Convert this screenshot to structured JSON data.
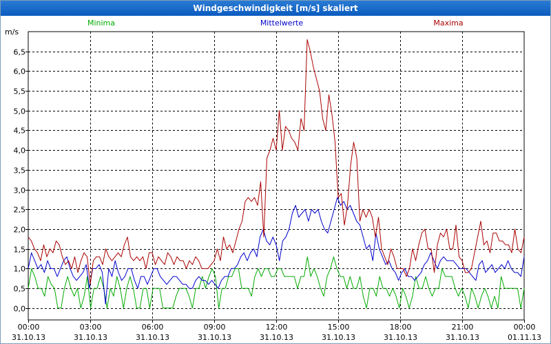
{
  "window": {
    "title": "Windgeschwindigkeit [m/s] skaliert"
  },
  "colors": {
    "minima": "#00aa00",
    "mittelwerte": "#0000cc",
    "maxima": "#aa0000",
    "grid": "#000000",
    "title_bar": "#0b5bbf"
  },
  "chart_data": {
    "type": "line",
    "title": "Windgeschwindigkeit [m/s] skaliert",
    "ylabel": "m/s",
    "xlabel": "",
    "ylim": [
      -0.3,
      7.0
    ],
    "y_ticks": [
      "0,0",
      "0,5",
      "1,0",
      "1,5",
      "2,0",
      "2,5",
      "3,0",
      "3,5",
      "4,0",
      "4,5",
      "5,0",
      "5,5",
      "6,0",
      "6,5"
    ],
    "y_tick_values": [
      0,
      0.5,
      1.0,
      1.5,
      2.0,
      2.5,
      3.0,
      3.5,
      4.0,
      4.5,
      5.0,
      5.5,
      6.0,
      6.5
    ],
    "x_range_hours": [
      0,
      24
    ],
    "x_ticks": [
      {
        "time": "00:00",
        "date": "31.10.13"
      },
      {
        "time": "03:00",
        "date": "31.10.13"
      },
      {
        "time": "06:00",
        "date": "31.10.13"
      },
      {
        "time": "09:00",
        "date": "31.10.13"
      },
      {
        "time": "12:00",
        "date": "31.10.13"
      },
      {
        "time": "15:00",
        "date": "31.10.13"
      },
      {
        "time": "18:00",
        "date": "31.10.13"
      },
      {
        "time": "21:00",
        "date": "31.10.13"
      },
      {
        "time": "00:00",
        "date": "01.11.13"
      }
    ],
    "grid": true,
    "legend_placement": "top",
    "series": [
      {
        "name": "Minima",
        "color": "#00aa00",
        "values": [
          0.5,
          1.0,
          0.8,
          0.5,
          0.5,
          0.3,
          0.8,
          0.6,
          0.5,
          0.0,
          0.0,
          0.5,
          0.8,
          0.5,
          0.3,
          0.5,
          0.0,
          0.3,
          0.8,
          0.0,
          0.5,
          0.5,
          0.8,
          0.5,
          0.0,
          0.5,
          0.3,
          0.8,
          0.5,
          0.0,
          0.5,
          0.8,
          0.5,
          0.0,
          0.0,
          0.5,
          0.5,
          0.0,
          0.5,
          0.5,
          0.5,
          0.0,
          0.0,
          0.0,
          0.0,
          0.3,
          0.5,
          0.5,
          0.5,
          0.3,
          0.0,
          0.5,
          0.5,
          0.8,
          0.5,
          0.8,
          1.0,
          0.8,
          0.0,
          0.5,
          0.5,
          0.8,
          0.8,
          1.0,
          1.0,
          0.5,
          0.5,
          0.5,
          0.3,
          0.8,
          1.0,
          0.8,
          1.0,
          1.0,
          0.8,
          0.8,
          1.0,
          1.0,
          0.8,
          0.8,
          0.8,
          0.8,
          0.5,
          0.8,
          0.8,
          1.3,
          0.8,
          1.0,
          0.8,
          0.5,
          0.3,
          0.8,
          1.0,
          1.3,
          1.0,
          0.8,
          0.8,
          0.5,
          0.8,
          0.5,
          0.5,
          0.8,
          0.3,
          0.0,
          0.5,
          0.5,
          0.3,
          0.8,
          0.5,
          0.5,
          0.3,
          0.5,
          0.3,
          0.0,
          0.5,
          0.3,
          0.0,
          0.3,
          0.8,
          0.5,
          0.5,
          0.8,
          0.5,
          0.3,
          0.5,
          0.5,
          1.0,
          0.8,
          0.8,
          0.8,
          0.5,
          0.3,
          0.5,
          0.3,
          0.0,
          0.5,
          0.3,
          0.0,
          0.3,
          0.5,
          0.3,
          0.0,
          0.3,
          0.0,
          0.8,
          0.5,
          0.5,
          0.5,
          0.5,
          0.5,
          0.0,
          0.5
        ]
      },
      {
        "name": "Mittelwerte",
        "color": "#0000cc",
        "values": [
          1.0,
          1.4,
          1.2,
          1.0,
          1.1,
          0.9,
          1.2,
          1.0,
          1.0,
          0.8,
          1.0,
          1.2,
          1.3,
          1.0,
          0.8,
          0.7,
          0.8,
          0.9,
          1.1,
          0.5,
          1.0,
          1.0,
          1.1,
          0.9,
          0.1,
          1.0,
          0.8,
          1.2,
          0.9,
          0.7,
          0.8,
          1.0,
          1.0,
          0.7,
          0.5,
          0.8,
          0.8,
          0.6,
          0.8,
          1.0,
          1.0,
          0.8,
          0.7,
          0.6,
          0.7,
          0.8,
          0.8,
          0.7,
          0.6,
          0.6,
          0.5,
          0.5,
          0.7,
          0.8,
          0.7,
          0.7,
          0.6,
          0.7,
          0.6,
          0.5,
          0.7,
          0.8,
          0.8,
          1.0,
          1.0,
          1.1,
          1.3,
          1.4,
          1.2,
          1.4,
          1.5,
          1.3,
          1.8,
          2.0,
          1.7,
          1.6,
          1.8,
          1.6,
          1.2,
          1.7,
          1.8,
          2.0,
          2.4,
          2.6,
          2.3,
          2.4,
          2.5,
          2.2,
          2.5,
          2.4,
          2.5,
          2.2,
          2.0,
          1.9,
          2.2,
          2.5,
          2.8,
          2.6,
          2.7,
          2.5,
          2.6,
          2.4,
          2.2,
          2.1,
          1.8,
          1.5,
          1.6,
          1.2,
          1.9,
          1.5,
          1.3,
          1.1,
          1.2,
          1.0,
          0.9,
          0.7,
          0.9,
          1.0,
          0.8,
          0.8,
          0.7,
          0.8,
          0.9,
          1.1,
          1.2,
          1.4,
          1.2,
          1.0,
          1.2,
          1.3,
          1.2,
          1.2,
          1.2,
          1.1,
          1.0,
          1.0,
          1.0,
          0.9,
          0.8,
          0.7,
          1.1,
          1.2,
          0.9,
          1.0,
          1.1,
          0.9,
          1.0,
          1.1,
          1.0,
          1.2,
          1.0,
          0.9,
          0.9,
          0.8,
          1.3
        ]
      },
      {
        "name": "Maxima",
        "color": "#aa0000",
        "values": [
          1.8,
          1.7,
          1.5,
          1.4,
          1.2,
          1.6,
          1.3,
          1.5,
          1.4,
          1.7,
          1.6,
          1.3,
          1.1,
          1.2,
          1.0,
          1.3,
          0.9,
          1.2,
          1.4,
          1.3,
          0.6,
          1.2,
          1.3,
          1.3,
          1.1,
          1.5,
          1.3,
          1.2,
          1.3,
          1.4,
          1.3,
          1.6,
          1.8,
          1.3,
          1.2,
          1.3,
          1.2,
          1.3,
          1.0,
          1.4,
          1.4,
          1.1,
          1.3,
          1.2,
          1.1,
          1.4,
          1.3,
          1.1,
          1.3,
          1.2,
          1.2,
          1.0,
          1.2,
          1.1,
          1.3,
          1.2,
          1.0,
          1.0,
          1.0,
          1.1,
          1.2,
          1.5,
          1.2,
          1.8,
          1.5,
          1.6,
          1.4,
          1.7,
          2.0,
          2.2,
          2.7,
          2.8,
          2.7,
          2.8,
          2.6,
          3.2,
          1.8,
          3.8,
          4.0,
          4.3,
          4.0,
          5.0,
          4.0,
          4.6,
          4.5,
          4.3,
          4.2,
          4.0,
          4.8,
          4.5,
          6.8,
          6.5,
          6.1,
          5.8,
          5.5,
          4.8,
          4.5,
          5.4,
          4.9,
          4.2,
          2.8,
          2.9,
          2.1,
          2.6,
          3.6,
          4.2,
          3.8,
          2.2,
          2.5,
          2.3,
          2.5,
          2.3,
          1.8,
          2.3,
          1.5,
          1.3,
          1.1,
          1.5,
          1.3,
          1.0,
          1.0,
          1.0,
          0.8,
          1.0,
          1.5,
          1.2,
          1.6,
          1.9,
          2.0,
          1.5,
          1.5,
          0.9,
          1.6,
          1.9,
          1.8,
          2.0,
          1.5,
          1.5,
          2.1,
          1.3,
          1.2,
          0.9,
          0.9,
          1.0,
          1.4,
          1.8,
          2.2,
          1.6,
          1.7,
          1.4,
          1.9,
          1.9,
          1.7,
          1.7,
          1.6,
          1.6,
          1.4,
          2.0,
          1.5,
          1.4,
          1.8
        ]
      }
    ]
  }
}
